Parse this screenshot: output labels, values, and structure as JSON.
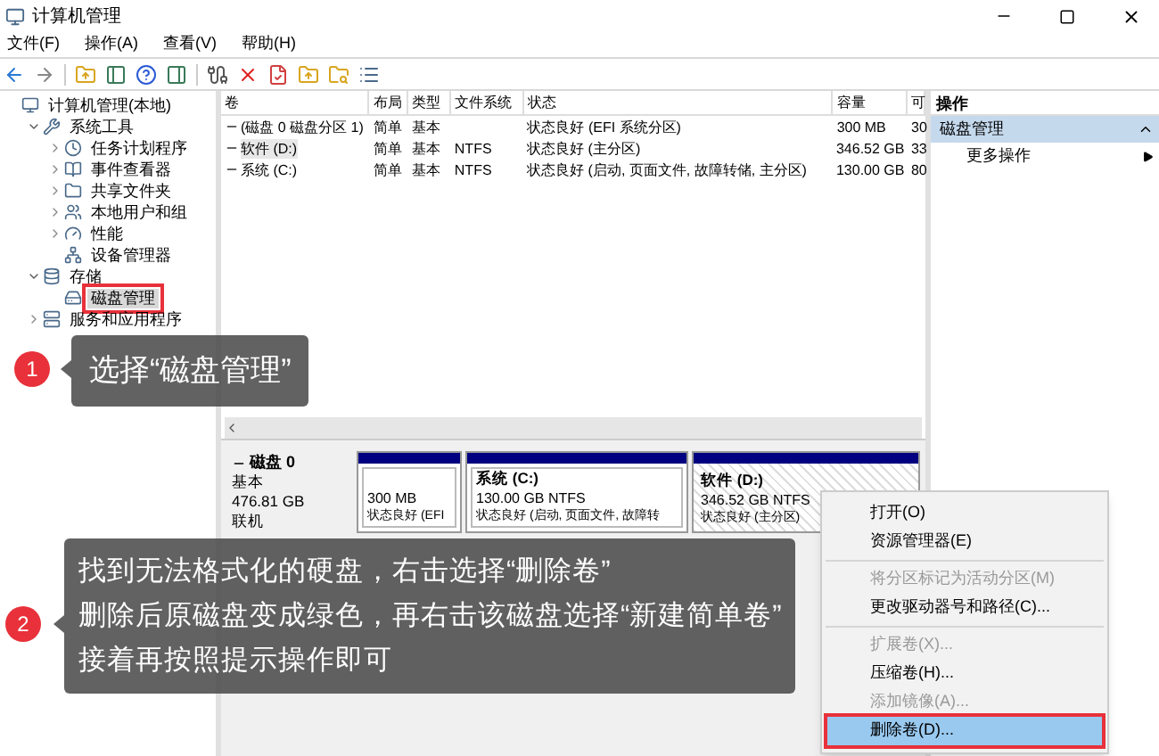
{
  "window": {
    "title": "计算机管理"
  },
  "menu_bar": [
    "文件(F)",
    "操作(A)",
    "查看(V)",
    "帮助(H)"
  ],
  "tree": [
    {
      "label": "计算机管理(本地)",
      "selected": false,
      "children": [
        {
          "label": "系统工具",
          "selected": false,
          "expanded": true,
          "children": [
            {
              "label": "任务计划程序",
              "selected": false,
              "expanded": false
            },
            {
              "label": "事件查看器",
              "selected": false,
              "expanded": false
            },
            {
              "label": "共享文件夹",
              "selected": false,
              "expanded": false
            },
            {
              "label": "本地用户和组",
              "selected": false,
              "expanded": false
            },
            {
              "label": "性能",
              "selected": false,
              "expanded": false
            },
            {
              "label": "设备管理器",
              "selected": false
            }
          ]
        },
        {
          "label": "存储",
          "selected": false,
          "expanded": true,
          "children": [
            {
              "label": "磁盘管理",
              "selected": true,
              "highlighted": true
            }
          ]
        },
        {
          "label": "服务和应用程序",
          "selected": false,
          "expanded": false
        }
      ]
    }
  ],
  "volumes": {
    "columns": [
      "卷",
      "布局",
      "类型",
      "文件系统",
      "状态",
      "容量",
      "可"
    ],
    "rows": [
      {
        "volume": "(磁盘 0 磁盘分区 1)",
        "layout": "简单",
        "type": "基本",
        "status": "状态良好 (EFI 系统分区)",
        "capacity": "300 MB",
        "column_7": "30",
        "selected": false
      },
      {
        "volume": "软件 (D:)",
        "layout": "简单",
        "type": "基本",
        "file_system": "NTFS",
        "status": "状态良好 (主分区)",
        "capacity": "346.52 GB",
        "column_7": "33",
        "selected": true
      },
      {
        "volume": "系统 (C:)",
        "layout": "简单",
        "type": "基本",
        "file_system": "NTFS",
        "status": "状态良好 (启动, 页面文件, 故障转储, 主分区)",
        "capacity": "130.00 GB",
        "column_7": "80",
        "selected": false
      }
    ]
  },
  "actions": {
    "title": "操作",
    "sections": [
      {
        "label": "磁盘管理",
        "expanded": true,
        "items": [
          "更多操作"
        ]
      }
    ]
  },
  "disk": {
    "name": "磁盘 0",
    "details": [
      "基本",
      "476.81 GB",
      "联机"
    ],
    "partitions": [
      {
        "size": "300 MB",
        "status": "状态良好 (EFI",
        "selected": false
      },
      {
        "name": "系统 (C:)",
        "size": "130.00 GB NTFS",
        "status": "状态良好 (启动, 页面文件, 故障转",
        "selected": false
      },
      {
        "name": "软件 (D:)",
        "size": "346.52 GB NTFS",
        "status": "状态良好 (主分区)",
        "selected": true
      }
    ]
  },
  "context_menu": [
    {
      "kind": "item",
      "label": "打开(O)",
      "disabled": false,
      "selected": false
    },
    {
      "kind": "item",
      "label": "资源管理器(E)",
      "disabled": false,
      "selected": false
    },
    {
      "kind": "separator"
    },
    {
      "kind": "item",
      "label": "将分区标记为活动分区(M)",
      "disabled": true,
      "selected": false
    },
    {
      "kind": "item",
      "label": "更改驱动器号和路径(C)...",
      "disabled": false,
      "selected": false
    },
    {
      "kind": "separator"
    },
    {
      "kind": "item",
      "label": "扩展卷(X)...",
      "disabled": true,
      "selected": false
    },
    {
      "kind": "item",
      "label": "压缩卷(H)...",
      "disabled": false,
      "selected": false
    },
    {
      "kind": "item",
      "label": "添加镜像(A)...",
      "disabled": true,
      "selected": false
    },
    {
      "kind": "item",
      "label": "删除卷(D)...",
      "disabled": false,
      "selected": true,
      "highlighted": true
    }
  ],
  "callouts": [
    {
      "number": "1",
      "lines": [
        "选择“磁盘管理”"
      ]
    },
    {
      "number": "2",
      "lines": [
        "找到无法格式化的硬盘，右击选择“删除卷”",
        "删除后原磁盘变成绿色，再右击该磁盘选择“新建简单卷”",
        "接着再按照提示操作即可"
      ]
    }
  ]
}
